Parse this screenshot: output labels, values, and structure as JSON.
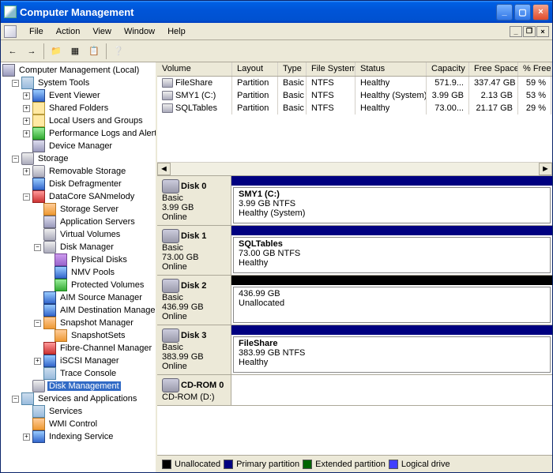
{
  "title": "Computer Management",
  "menu": {
    "file": "File",
    "action": "Action",
    "view": "View",
    "window": "Window",
    "help": "Help"
  },
  "tree": {
    "root": "Computer Management (Local)",
    "systools": "System Tools",
    "evtviewer": "Event Viewer",
    "sharedfolders": "Shared Folders",
    "localusers": "Local Users and Groups",
    "perflogs": "Performance Logs and Alerts",
    "devmgr": "Device Manager",
    "storage": "Storage",
    "removable": "Removable Storage",
    "defrag": "Disk Defragmenter",
    "datacore": "DataCore SANmelody",
    "storagesrv": "Storage Server",
    "appsrv": "Application Servers",
    "virtvols": "Virtual Volumes",
    "diskmgr_dc": "Disk Manager",
    "physdisks": "Physical Disks",
    "nmvpools": "NMV Pools",
    "protvols": "Protected Volumes",
    "aimsrc": "AIM Source Manager",
    "aimdst": "AIM Destination Manager",
    "snapmgr": "Snapshot Manager",
    "snapset": "SnapshotSets",
    "fcmgr": "Fibre-Channel Manager",
    "iscsi": "iSCSI Manager",
    "trace": "Trace Console",
    "diskmgmt": "Disk Management",
    "svcapps": "Services and Applications",
    "services": "Services",
    "wmi": "WMI Control",
    "indexing": "Indexing Service"
  },
  "volcols": {
    "volume": "Volume",
    "layout": "Layout",
    "type": "Type",
    "fs": "File System",
    "status": "Status",
    "capacity": "Capacity",
    "free": "Free Space",
    "pct": "% Free"
  },
  "volumes": [
    {
      "name": "FileShare",
      "layout": "Partition",
      "type": "Basic",
      "fs": "NTFS",
      "status": "Healthy",
      "capacity": "571.9...",
      "free": "337.47 GB",
      "pct": "59 %"
    },
    {
      "name": "SMY1 (C:)",
      "layout": "Partition",
      "type": "Basic",
      "fs": "NTFS",
      "status": "Healthy (System)",
      "capacity": "3.99 GB",
      "free": "2.13 GB",
      "pct": "53 %"
    },
    {
      "name": "SQLTables",
      "layout": "Partition",
      "type": "Basic",
      "fs": "NTFS",
      "status": "Healthy",
      "capacity": "73.00...",
      "free": "21.17 GB",
      "pct": "29 %"
    }
  ],
  "disks": [
    {
      "name": "Disk 0",
      "kind": "Basic",
      "size": "3.99 GB",
      "state": "Online",
      "bar": "blue",
      "vol": {
        "name": "SMY1  (C:)",
        "detail": "3.99 GB NTFS",
        "status": "Healthy (System)"
      }
    },
    {
      "name": "Disk 1",
      "kind": "Basic",
      "size": "73.00 GB",
      "state": "Online",
      "bar": "blue",
      "vol": {
        "name": "SQLTables",
        "detail": "73.00 GB NTFS",
        "status": "Healthy"
      }
    },
    {
      "name": "Disk 2",
      "kind": "Basic",
      "size": "436.99 GB",
      "state": "Online",
      "bar": "black",
      "vol": {
        "name": "",
        "detail": "436.99 GB",
        "status": "Unallocated"
      }
    },
    {
      "name": "Disk 3",
      "kind": "Basic",
      "size": "383.99 GB",
      "state": "Online",
      "bar": "blue",
      "vol": {
        "name": "FileShare",
        "detail": "383.99 GB NTFS",
        "status": "Healthy"
      }
    }
  ],
  "cdrom": {
    "name": "CD-ROM 0",
    "sub": "CD-ROM (D:)"
  },
  "legend": {
    "unalloc": "Unallocated",
    "primary": "Primary partition",
    "extended": "Extended partition",
    "logical": "Logical drive"
  }
}
